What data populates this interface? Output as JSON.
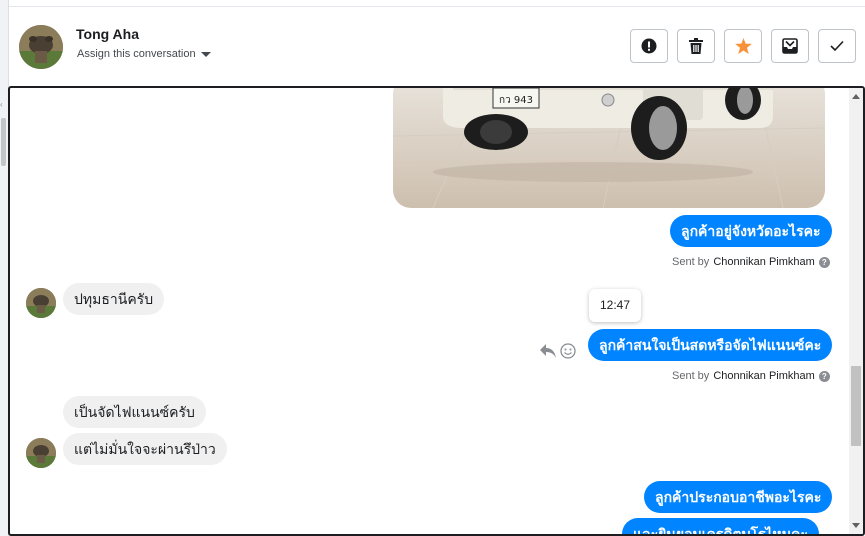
{
  "contact": {
    "name": "Tong Aha",
    "assign_label": "Assign this conversation"
  },
  "actions": [
    {
      "icon": "spam-icon",
      "color": "#1c1e21"
    },
    {
      "icon": "trash-icon",
      "color": "#1c1e21"
    },
    {
      "icon": "star-icon",
      "color": "#f7923a"
    },
    {
      "icon": "archive-icon",
      "color": "#1c1e21"
    },
    {
      "icon": "check-icon",
      "color": "#1c1e21"
    }
  ],
  "messages": {
    "out1": "ลูกค้าอยู่จังหวัดอะไรคะ",
    "in1": "ปทุมธานีครับ",
    "out2": "ลูกค้าสนใจเป็นสดหรือจัดไฟแนนซ์คะ",
    "in2": "เป็นจัดไฟแนนซ์ครับ",
    "in3": "แต่ไม่มั่นใจจะผ่านรึป่าว",
    "out3": "ลูกค้าประกอบอาชีพอะไรคะ",
    "out4": "และยินยอมเครดิตบูโรไหมคะ"
  },
  "sent_by": {
    "prefix": "Sent by",
    "agent": "Chonnikan Pimkham",
    "help": "?"
  },
  "tooltip_time": "12:47",
  "car_plate": "กว 943",
  "colors": {
    "accent": "#0084ff",
    "incoming_bubble": "#f0f0f0",
    "star": "#f7923a"
  }
}
